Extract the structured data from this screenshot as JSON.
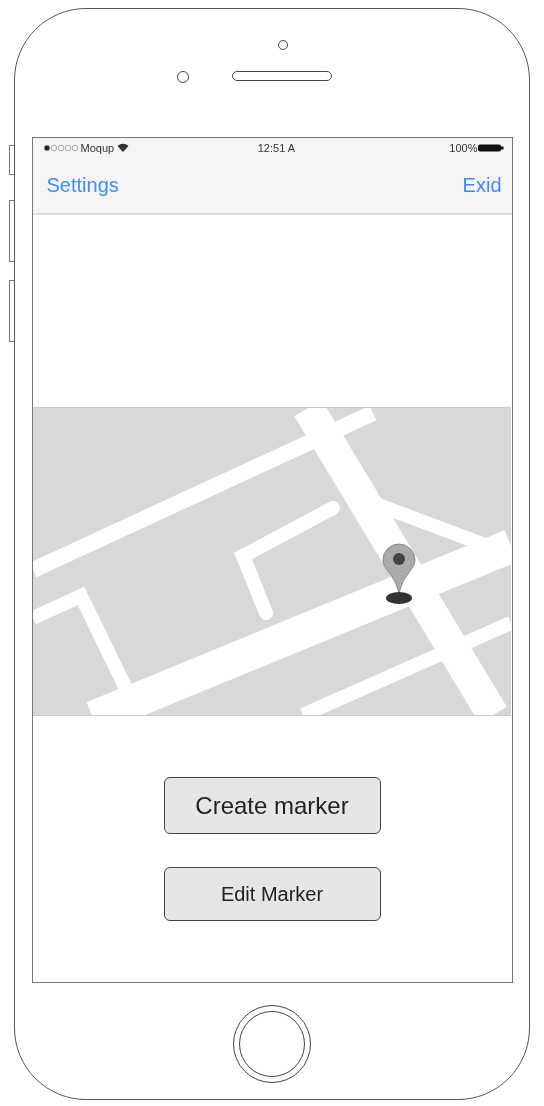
{
  "status_bar": {
    "carrier": "Moqup",
    "time": "12:51 A",
    "battery": "100%"
  },
  "nav_bar": {
    "left": "Settings",
    "right": "Exid"
  },
  "buttons": [
    {
      "label": "Create marker",
      "kind": "large"
    },
    {
      "label": "Edit Marker",
      "kind": "small"
    }
  ]
}
